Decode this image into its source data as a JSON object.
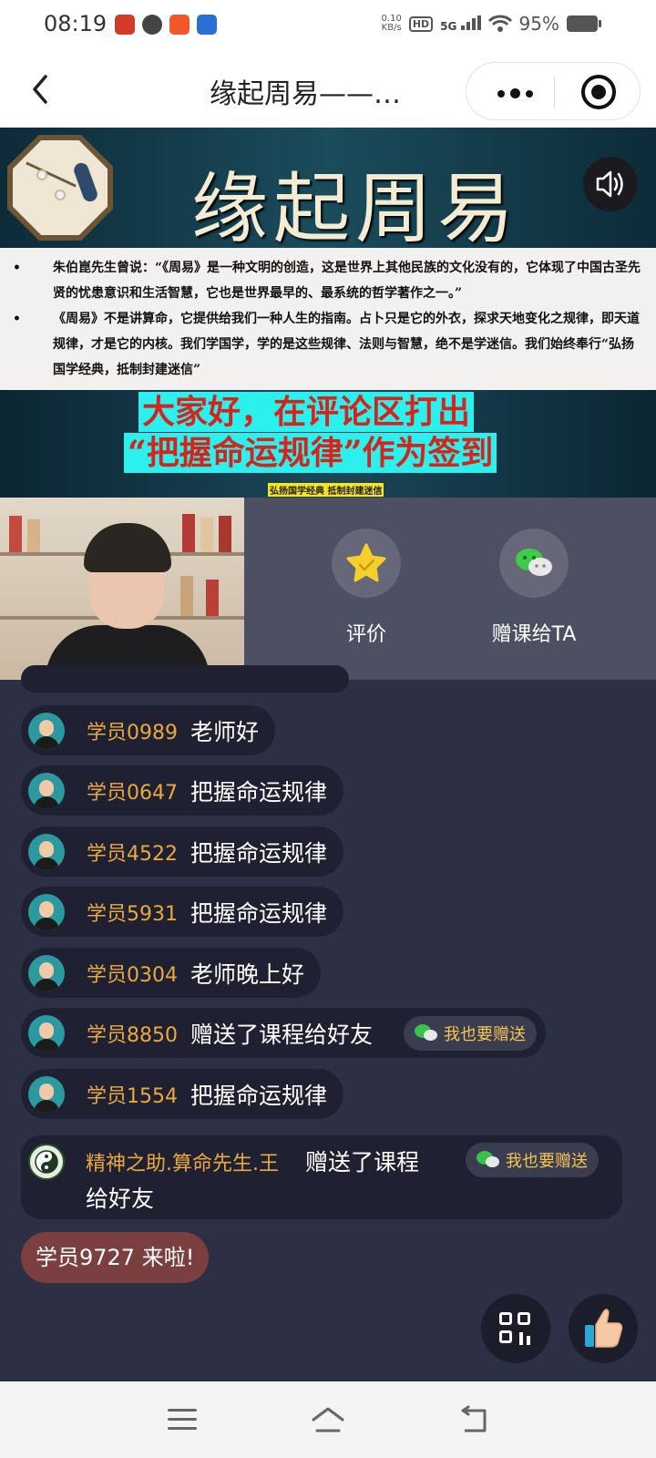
{
  "status_bar": {
    "time": "08:19",
    "net_speed_value": "0.10",
    "net_speed_unit": "KB/s",
    "hd_label": "HD",
    "network": "5G",
    "battery": "95%"
  },
  "nav": {
    "title": "缘起周易——…"
  },
  "banner": {
    "title": "缘起周易",
    "paragraphs": [
      "朱伯崑先生曾说：“《周易》是一种文明的创造，这是世界上其他民族的文化没有的，它体现了中国古圣先贤的忧患意识和生活智慧，它也是世界最早的、最系统的哲学著作之一。”",
      "《周易》不是讲算命，它提供给我们一种人生的指南。占卜只是它的外衣，探求天地变化之规律，即天道规律，才是它的内核。我们学国学，学的是这些规律、法则与智慧，绝不是学迷信。我们始终奉行“弘扬国学经典，抵制封建迷信”"
    ],
    "callout_line1": "大家好，在评论区打出",
    "callout_line2": "“把握命运规律”作为签到",
    "small_label": "弘扬国学经典 抵制封建迷信"
  },
  "actions": {
    "rate_label": "评价",
    "gift_label": "赠课给TA"
  },
  "chat": {
    "messages": [
      {
        "user": "学员0989",
        "text": "老师好"
      },
      {
        "user": "学员0647",
        "text": "把握命运规律"
      },
      {
        "user": "学员4522",
        "text": "把握命运规律"
      },
      {
        "user": "学员5931",
        "text": "把握命运规律"
      },
      {
        "user": "学员0304",
        "text": "老师晚上好"
      },
      {
        "user": "学员8850",
        "text": "赠送了课程给好友",
        "button": "我也要赠送"
      },
      {
        "user": "学员1554",
        "text": "把握命运规律"
      }
    ],
    "special": {
      "user": "精神之助.算命先生.王",
      "text_line1": "赠送了课程",
      "text_line2": "给好友",
      "button": "我也要赠送"
    },
    "arrival": "学员9727 来啦!"
  },
  "icons": {
    "back": "chevron-left-icon",
    "more": "more-dots-icon",
    "close_miniapp": "target-icon",
    "sound": "speaker-icon",
    "rate": "star-icon",
    "gift": "wechat-icon",
    "qr": "qr-code-icon",
    "like": "thumbs-up-icon"
  },
  "colors": {
    "chat_bg": "#2d2f45",
    "username": "#e9a93e",
    "gift_button_text": "#f4c550",
    "callout_highlight": "#2cf0ee",
    "callout_text": "#d4241b"
  }
}
